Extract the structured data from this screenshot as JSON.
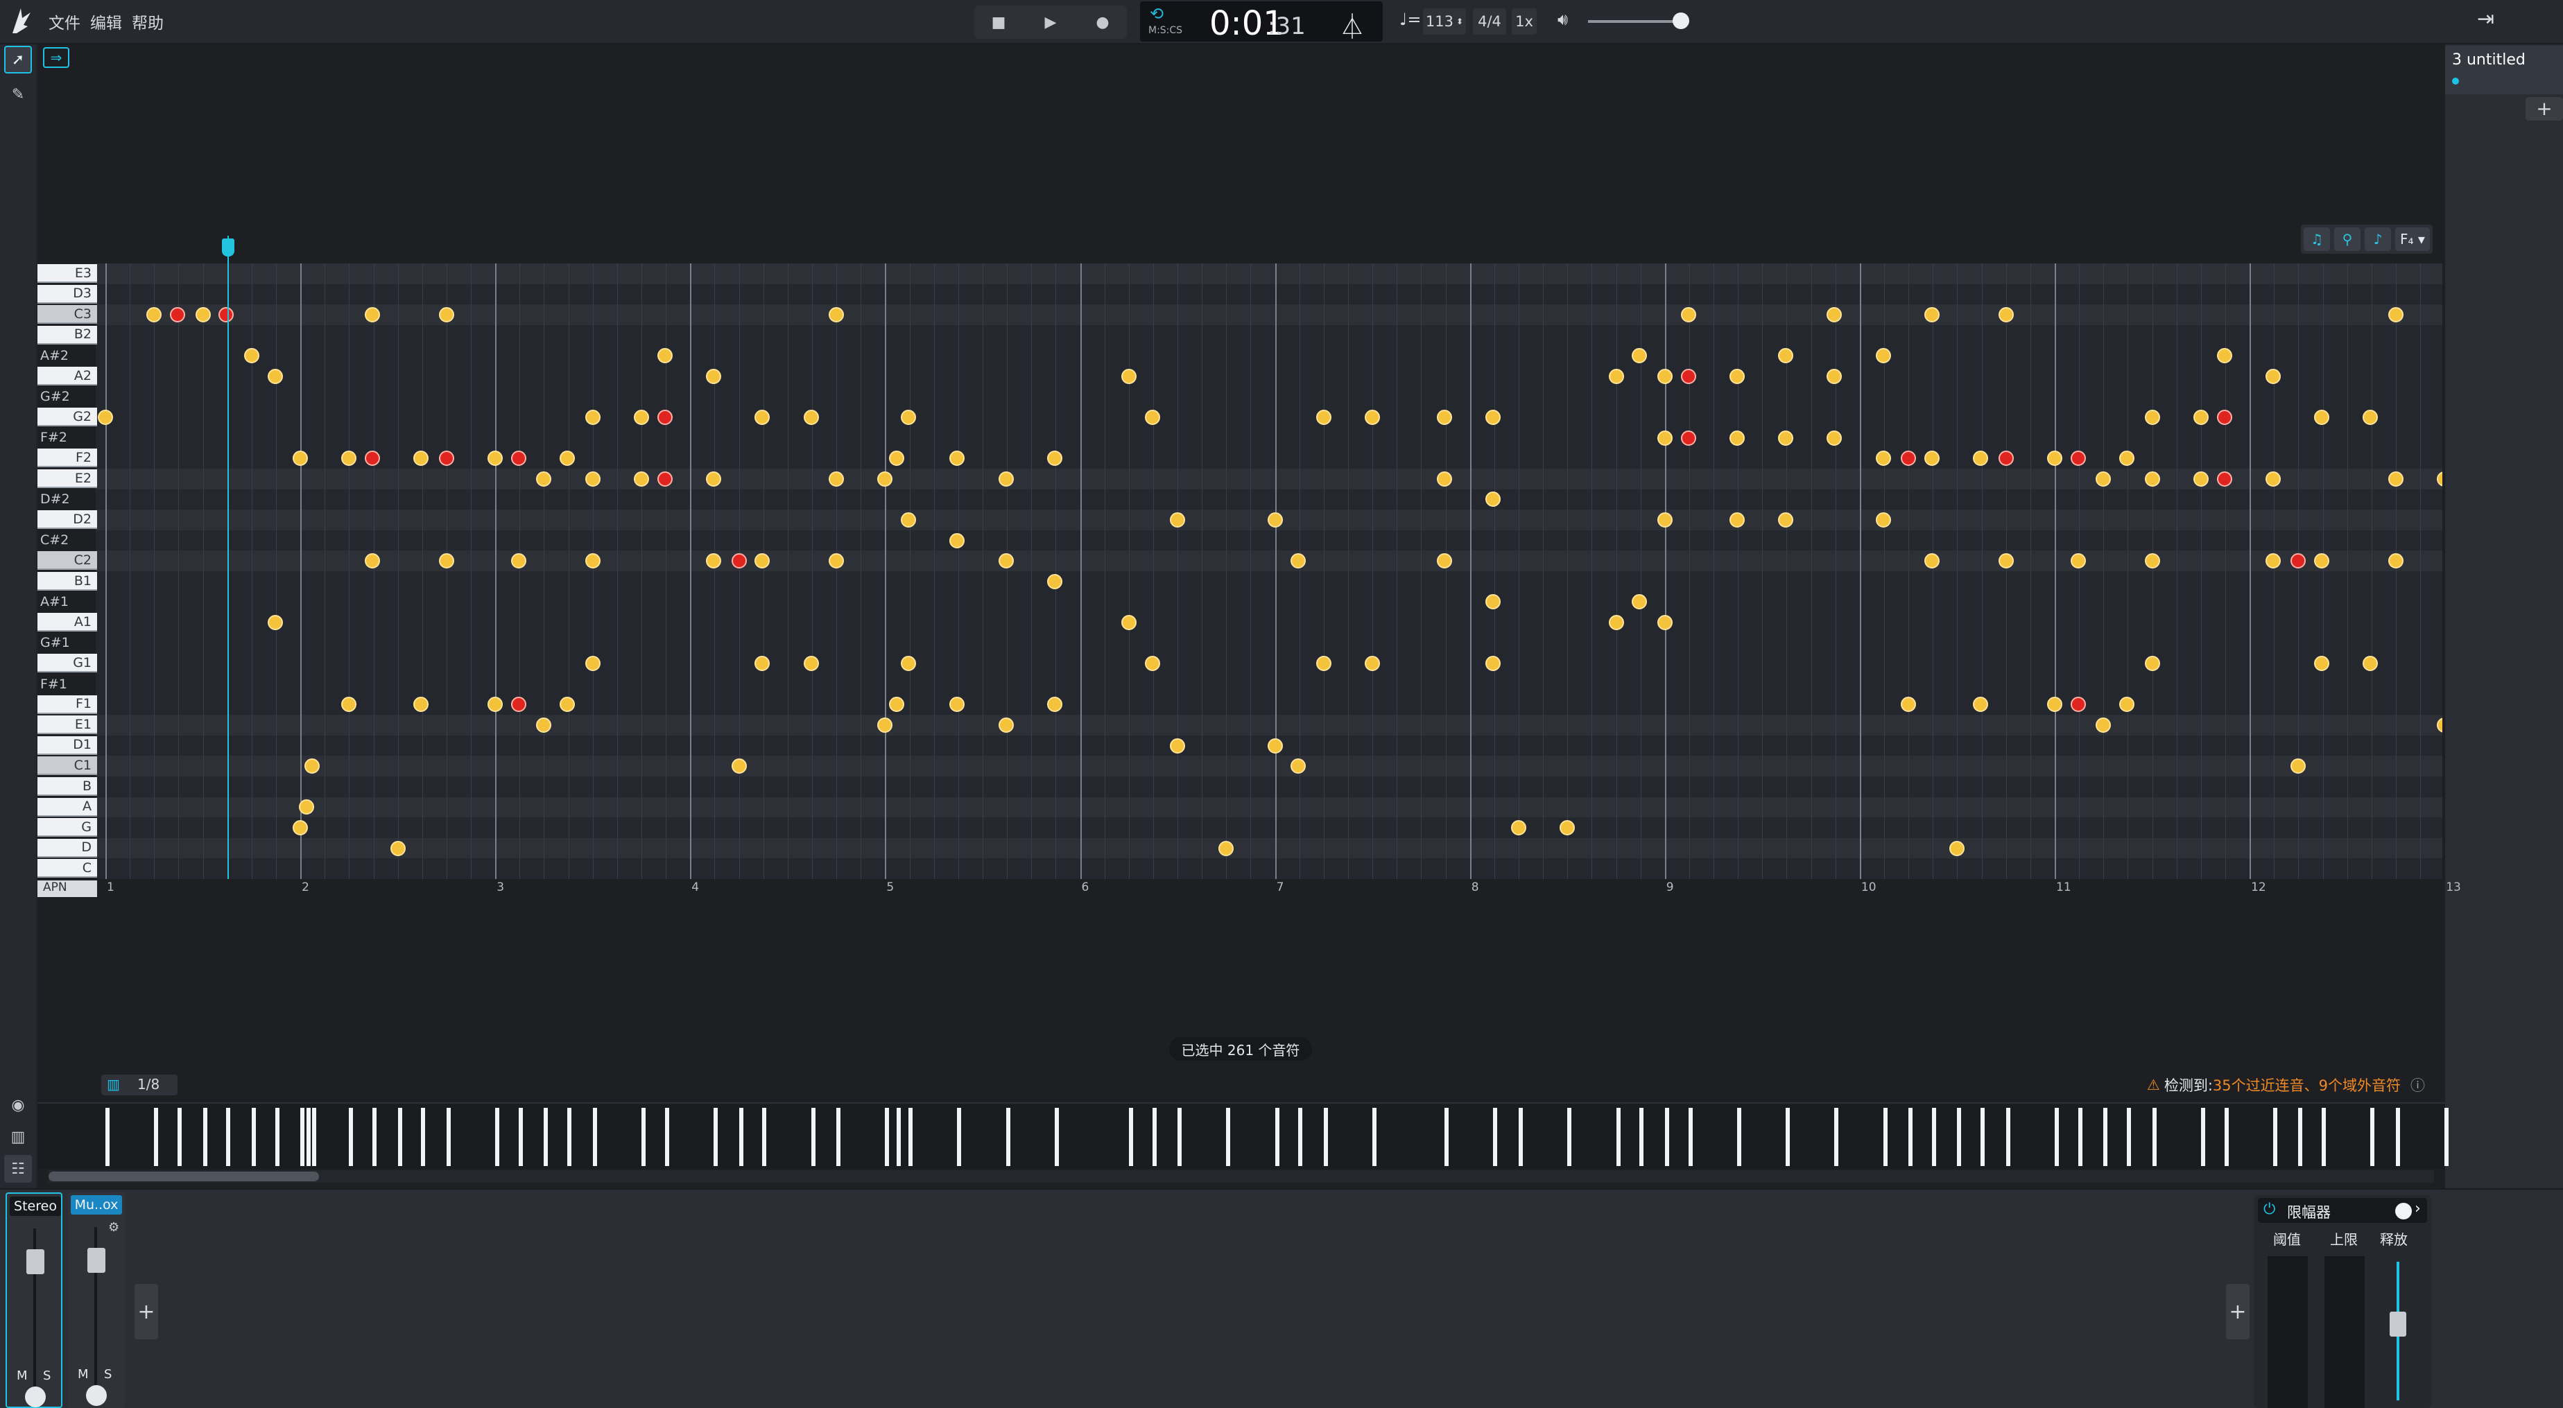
{
  "menu": {
    "file": "文件",
    "edit": "编辑",
    "help": "帮助"
  },
  "transport": {
    "time_main": "0:01",
    "time_frac": ":31",
    "time_mode": "M:S:CS"
  },
  "controls": {
    "tempo": "113",
    "time_sig": "4/4",
    "speed": "1x"
  },
  "project": {
    "name": "3 untitled"
  },
  "keys": [
    {
      "label": "E3",
      "type": "white"
    },
    {
      "label": "D3",
      "type": "white"
    },
    {
      "label": "C3",
      "type": "white-c"
    },
    {
      "label": "B2",
      "type": "white"
    },
    {
      "label": "A#2",
      "type": "black"
    },
    {
      "label": "A2",
      "type": "white"
    },
    {
      "label": "G#2",
      "type": "black"
    },
    {
      "label": "G2",
      "type": "white"
    },
    {
      "label": "F#2",
      "type": "black"
    },
    {
      "label": "F2",
      "type": "white"
    },
    {
      "label": "E2",
      "type": "white"
    },
    {
      "label": "D#2",
      "type": "black"
    },
    {
      "label": "D2",
      "type": "white"
    },
    {
      "label": "C#2",
      "type": "black"
    },
    {
      "label": "C2",
      "type": "white-c"
    },
    {
      "label": "B1",
      "type": "white"
    },
    {
      "label": "A#1",
      "type": "black"
    },
    {
      "label": "A1",
      "type": "white"
    },
    {
      "label": "G#1",
      "type": "black"
    },
    {
      "label": "G1",
      "type": "white"
    },
    {
      "label": "F#1",
      "type": "black"
    },
    {
      "label": "F1",
      "type": "white"
    },
    {
      "label": "E1",
      "type": "white"
    },
    {
      "label": "D1",
      "type": "white"
    },
    {
      "label": "C1",
      "type": "white-c"
    },
    {
      "label": "B",
      "type": "white"
    },
    {
      "label": "A",
      "type": "white"
    },
    {
      "label": "G",
      "type": "white"
    },
    {
      "label": "D",
      "type": "white"
    },
    {
      "label": "C",
      "type": "white"
    }
  ],
  "apn_label": "APN",
  "bars": [
    "1",
    "2",
    "3",
    "4",
    "5",
    "6",
    "7",
    "8",
    "9",
    "10",
    "11",
    "12",
    "13"
  ],
  "notes": [
    {
      "t": 1.0,
      "r": 7
    },
    {
      "t": 1.25,
      "r": 2
    },
    {
      "t": 1.37,
      "r": 2,
      "red": true
    },
    {
      "t": 1.5,
      "r": 2
    },
    {
      "t": 1.62,
      "r": 2,
      "red": true
    },
    {
      "t": 1.75,
      "r": 4
    },
    {
      "t": 1.87,
      "r": 5
    },
    {
      "t": 1.87,
      "r": 17
    },
    {
      "t": 2.0,
      "r": 9
    },
    {
      "t": 2.0,
      "r": 27
    },
    {
      "t": 2.03,
      "r": 26
    },
    {
      "t": 2.06,
      "r": 24
    },
    {
      "t": 2.25,
      "r": 9
    },
    {
      "t": 2.25,
      "r": 21
    },
    {
      "t": 2.37,
      "r": 2
    },
    {
      "t": 2.37,
      "r": 9,
      "red": true
    },
    {
      "t": 2.37,
      "r": 14
    },
    {
      "t": 2.5,
      "r": 28
    },
    {
      "t": 2.62,
      "r": 9
    },
    {
      "t": 2.62,
      "r": 21
    },
    {
      "t": 2.75,
      "r": 9,
      "red": true
    },
    {
      "t": 2.75,
      "r": 2
    },
    {
      "t": 2.75,
      "r": 14
    },
    {
      "t": 3.0,
      "r": 9
    },
    {
      "t": 3.0,
      "r": 21
    },
    {
      "t": 3.12,
      "r": 9,
      "red": true
    },
    {
      "t": 3.12,
      "r": 21,
      "red": true
    },
    {
      "t": 3.12,
      "r": 14
    },
    {
      "t": 3.25,
      "r": 10
    },
    {
      "t": 3.25,
      "r": 22
    },
    {
      "t": 3.37,
      "r": 9
    },
    {
      "t": 3.37,
      "r": 21
    },
    {
      "t": 3.5,
      "r": 7
    },
    {
      "t": 3.5,
      "r": 10
    },
    {
      "t": 3.5,
      "r": 14
    },
    {
      "t": 3.5,
      "r": 19
    },
    {
      "t": 3.75,
      "r": 7
    },
    {
      "t": 3.75,
      "r": 10
    },
    {
      "t": 3.87,
      "r": 7,
      "red": true
    },
    {
      "t": 3.87,
      "r": 10,
      "red": true
    },
    {
      "t": 3.87,
      "r": 4
    },
    {
      "t": 4.12,
      "r": 5
    },
    {
      "t": 4.12,
      "r": 10
    },
    {
      "t": 4.12,
      "r": 14
    },
    {
      "t": 4.25,
      "r": 14,
      "red": true
    },
    {
      "t": 4.25,
      "r": 24
    },
    {
      "t": 4.37,
      "r": 7
    },
    {
      "t": 4.37,
      "r": 14
    },
    {
      "t": 4.37,
      "r": 19
    },
    {
      "t": 4.62,
      "r": 7
    },
    {
      "t": 4.62,
      "r": 19
    },
    {
      "t": 4.75,
      "r": 2
    },
    {
      "t": 4.75,
      "r": 10
    },
    {
      "t": 4.75,
      "r": 14
    },
    {
      "t": 5.0,
      "r": 10
    },
    {
      "t": 5.0,
      "r": 22
    },
    {
      "t": 5.06,
      "r": 9
    },
    {
      "t": 5.06,
      "r": 21
    },
    {
      "t": 5.12,
      "r": 7
    },
    {
      "t": 5.12,
      "r": 12
    },
    {
      "t": 5.12,
      "r": 19
    },
    {
      "t": 5.37,
      "r": 9
    },
    {
      "t": 5.37,
      "r": 13
    },
    {
      "t": 5.37,
      "r": 21
    },
    {
      "t": 5.62,
      "r": 10
    },
    {
      "t": 5.62,
      "r": 14
    },
    {
      "t": 5.62,
      "r": 22
    },
    {
      "t": 5.87,
      "r": 9
    },
    {
      "t": 5.87,
      "r": 15
    },
    {
      "t": 5.87,
      "r": 21
    },
    {
      "t": 6.25,
      "r": 5
    },
    {
      "t": 6.25,
      "r": 17
    },
    {
      "t": 6.37,
      "r": 7
    },
    {
      "t": 6.37,
      "r": 19
    },
    {
      "t": 6.5,
      "r": 12
    },
    {
      "t": 6.5,
      "r": 23
    },
    {
      "t": 6.75,
      "r": 28
    },
    {
      "t": 7.0,
      "r": 12
    },
    {
      "t": 7.0,
      "r": 23
    },
    {
      "t": 7.12,
      "r": 14
    },
    {
      "t": 7.12,
      "r": 24
    },
    {
      "t": 7.25,
      "r": 7
    },
    {
      "t": 7.25,
      "r": 19
    },
    {
      "t": 7.5,
      "r": 7
    },
    {
      "t": 7.5,
      "r": 19
    },
    {
      "t": 7.87,
      "r": 7
    },
    {
      "t": 7.87,
      "r": 10
    },
    {
      "t": 7.87,
      "r": 14
    },
    {
      "t": 8.12,
      "r": 7
    },
    {
      "t": 8.12,
      "r": 11
    },
    {
      "t": 8.12,
      "r": 16
    },
    {
      "t": 8.12,
      "r": 19
    },
    {
      "t": 8.25,
      "r": 27
    },
    {
      "t": 8.5,
      "r": 27
    },
    {
      "t": 8.75,
      "r": 5
    },
    {
      "t": 8.75,
      "r": 17
    },
    {
      "t": 8.87,
      "r": 4
    },
    {
      "t": 8.87,
      "r": 16
    },
    {
      "t": 9.0,
      "r": 5
    },
    {
      "t": 9.0,
      "r": 8
    },
    {
      "t": 9.0,
      "r": 12
    },
    {
      "t": 9.0,
      "r": 17
    },
    {
      "t": 9.12,
      "r": 2
    },
    {
      "t": 9.12,
      "r": 5,
      "red": true
    },
    {
      "t": 9.12,
      "r": 8,
      "red": true
    },
    {
      "t": 9.37,
      "r": 5
    },
    {
      "t": 9.37,
      "r": 8
    },
    {
      "t": 9.37,
      "r": 12
    },
    {
      "t": 9.62,
      "r": 4
    },
    {
      "t": 9.62,
      "r": 8
    },
    {
      "t": 9.62,
      "r": 12
    },
    {
      "t": 9.87,
      "r": 2
    },
    {
      "t": 9.87,
      "r": 5
    },
    {
      "t": 9.87,
      "r": 8
    },
    {
      "t": 10.12,
      "r": 4
    },
    {
      "t": 10.12,
      "r": 9
    },
    {
      "t": 10.12,
      "r": 12
    },
    {
      "t": 10.25,
      "r": 9,
      "red": true
    },
    {
      "t": 10.25,
      "r": 21
    },
    {
      "t": 10.37,
      "r": 2
    },
    {
      "t": 10.37,
      "r": 9
    },
    {
      "t": 10.37,
      "r": 14
    },
    {
      "t": 10.5,
      "r": 28
    },
    {
      "t": 10.62,
      "r": 9
    },
    {
      "t": 10.62,
      "r": 21
    },
    {
      "t": 10.75,
      "r": 2
    },
    {
      "t": 10.75,
      "r": 9,
      "red": true
    },
    {
      "t": 10.75,
      "r": 14
    },
    {
      "t": 11.0,
      "r": 9
    },
    {
      "t": 11.0,
      "r": 21
    },
    {
      "t": 11.12,
      "r": 9,
      "red": true
    },
    {
      "t": 11.12,
      "r": 21,
      "red": true
    },
    {
      "t": 11.12,
      "r": 14
    },
    {
      "t": 11.25,
      "r": 10
    },
    {
      "t": 11.25,
      "r": 22
    },
    {
      "t": 11.37,
      "r": 9
    },
    {
      "t": 11.37,
      "r": 21
    },
    {
      "t": 11.5,
      "r": 7
    },
    {
      "t": 11.5,
      "r": 10
    },
    {
      "t": 11.5,
      "r": 14
    },
    {
      "t": 11.5,
      "r": 19
    },
    {
      "t": 11.75,
      "r": 7
    },
    {
      "t": 11.75,
      "r": 10
    },
    {
      "t": 11.87,
      "r": 4
    },
    {
      "t": 11.87,
      "r": 7,
      "red": true
    },
    {
      "t": 11.87,
      "r": 10,
      "red": true
    },
    {
      "t": 12.12,
      "r": 5
    },
    {
      "t": 12.12,
      "r": 10
    },
    {
      "t": 12.12,
      "r": 14
    },
    {
      "t": 12.25,
      "r": 14,
      "red": true
    },
    {
      "t": 12.25,
      "r": 24
    },
    {
      "t": 12.37,
      "r": 7
    },
    {
      "t": 12.37,
      "r": 14
    },
    {
      "t": 12.37,
      "r": 19
    },
    {
      "t": 12.62,
      "r": 7
    },
    {
      "t": 12.62,
      "r": 19
    },
    {
      "t": 12.75,
      "r": 2
    },
    {
      "t": 12.75,
      "r": 10
    },
    {
      "t": 12.75,
      "r": 14
    },
    {
      "t": 13.0,
      "r": 10
    },
    {
      "t": 13.0,
      "r": 22
    }
  ],
  "status": {
    "selected": "已选中 261 个音符"
  },
  "quantize": "1/8",
  "warning": {
    "prefix": "检测到: ",
    "text": "35个过近连音、9个域外音符"
  },
  "mixer": {
    "stereo_label": "Stereo",
    "mu_label": "Mu..ox",
    "m": "M",
    "s": "S"
  },
  "limiter": {
    "title": "限幅器",
    "threshold": "阈值",
    "ceiling": "上限",
    "release": "释放"
  }
}
